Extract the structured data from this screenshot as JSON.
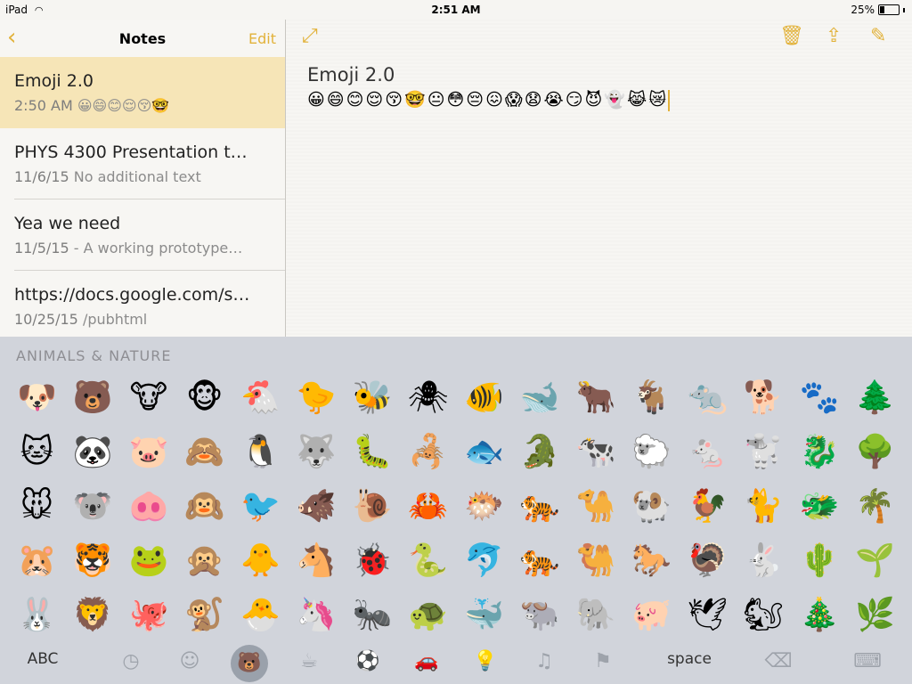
{
  "status": {
    "device": "iPad",
    "time": "2:51 AM",
    "battery": "25%",
    "battery_level": 0.25
  },
  "sidebar": {
    "title": "Notes",
    "edit": "Edit",
    "back_icon": "chevron-left-icon",
    "notes": [
      {
        "title": "Emoji 2.0",
        "date": "2:50 AM",
        "preview": "😀😄😊😌😚🤓"
      },
      {
        "title": "PHYS 4300 Presentation t…",
        "date": "11/6/15",
        "preview": "No additional text"
      },
      {
        "title": "Yea we need",
        "date": "11/5/15",
        "preview": "- A working prototype…"
      },
      {
        "title": "https://docs.google.com/s…",
        "date": "10/25/15",
        "preview": "/pubhtml"
      }
    ]
  },
  "editor": {
    "heading": "Emoji 2.0",
    "emoji": "😀😄😊😌😚🤓😐😳😔😖😱😧😭😏😈👻😹😿"
  },
  "keyboard": {
    "section": "ANIMALS & NATURE",
    "emoji": [
      "🐶",
      "🐻",
      "🐮",
      "🐵",
      "🐔",
      "🐤",
      "🐝",
      "🕷",
      "🐠",
      "🐋",
      "🐂",
      "🐐",
      "🐀",
      "🐕",
      "🐾",
      "🌲",
      "🐱",
      "🐼",
      "🐷",
      "🙈",
      "🐧",
      "🐺",
      "🐛",
      "🦂",
      "🐟",
      "🐊",
      "🐄",
      "🐑",
      "🐁",
      "🐩",
      "🐉",
      "🌳",
      "🐭",
      "🐨",
      "🐽",
      "🙉",
      "🐦",
      "🐗",
      "🐌",
      "🦀",
      "🐡",
      "🐅",
      "🐪",
      "🐏",
      "🐓",
      "🐈",
      "🐲",
      "🌴",
      "🐹",
      "🐯",
      "🐸",
      "🙊",
      "🐥",
      "🐴",
      "🐞",
      "🐍",
      "🐬",
      "🐅",
      "🐫",
      "🐎",
      "🦃",
      "🐇",
      "🌵",
      "🌱",
      "🐰",
      "🦁",
      "🐙",
      "🐒",
      "🐣",
      "🦄",
      "🐜",
      "🐢",
      "🐳",
      "🐃",
      "🐘",
      "🐖",
      "🕊",
      "🐿",
      "🎄",
      "🌿"
    ],
    "abc": "ABC",
    "space": "space"
  }
}
